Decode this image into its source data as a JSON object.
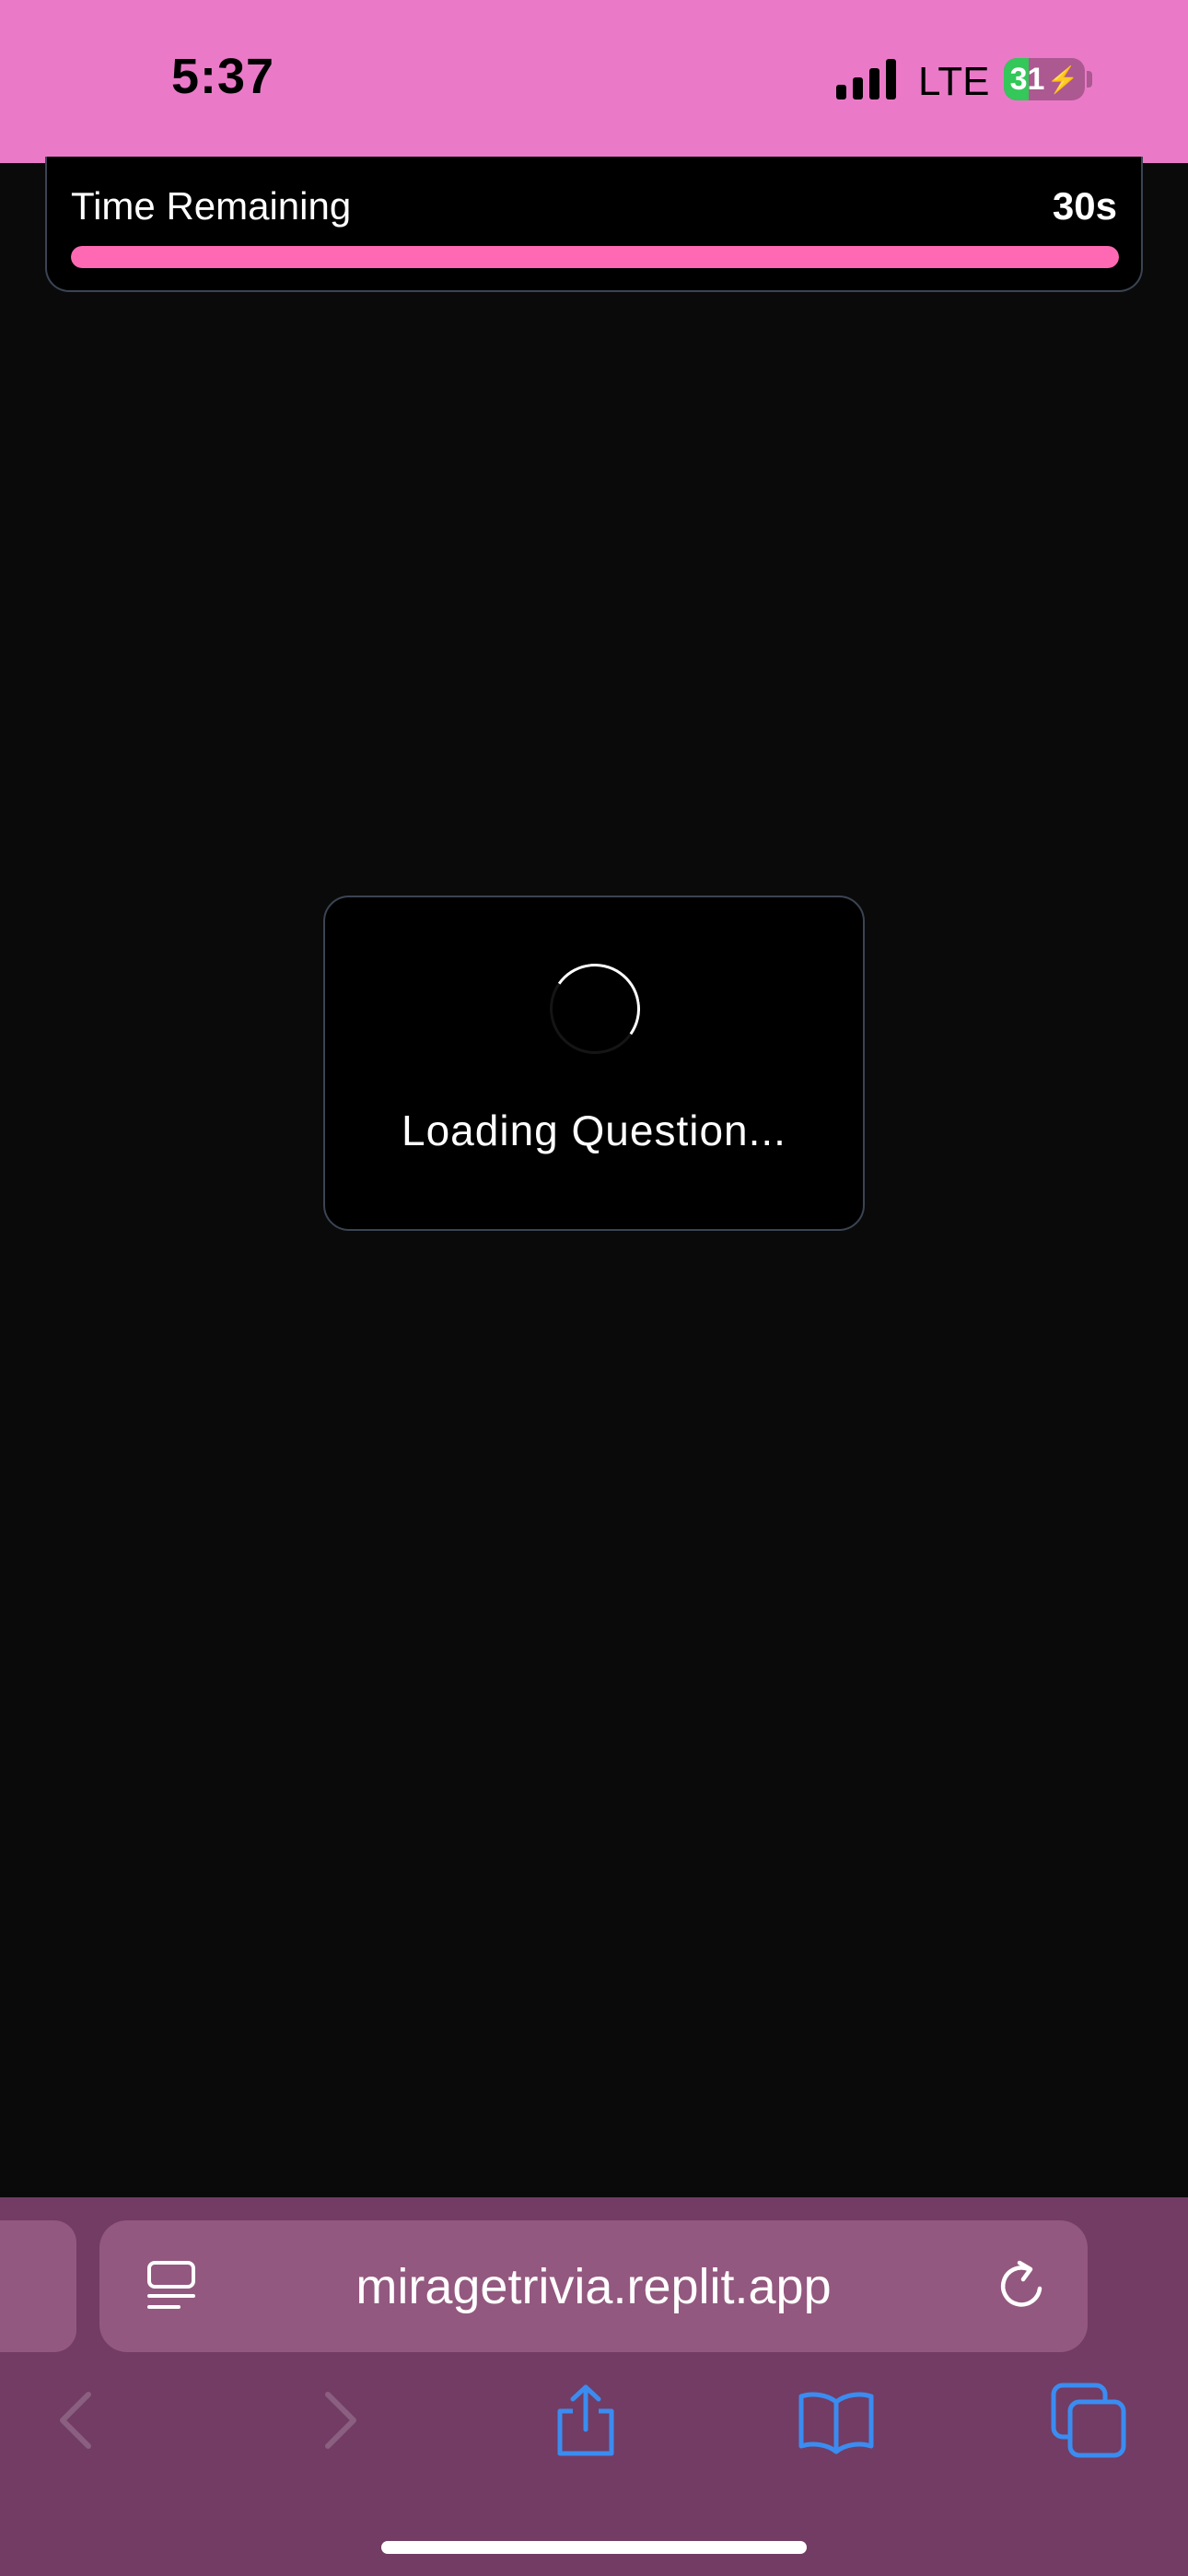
{
  "status_bar": {
    "time": "5:37",
    "network": "LTE",
    "battery_percent": "31",
    "battery_level": 0.31,
    "background_color": "#ea7ac8"
  },
  "timer": {
    "label": "Time Remaining",
    "value": "30s",
    "progress_fraction": 1.0,
    "progress_color": "#ff69b4"
  },
  "loading": {
    "text": "Loading Question..."
  },
  "browser": {
    "url": "miragetrivia.replit.app",
    "toolbar_color": "#723c64",
    "icons": [
      "reader-mode-icon",
      "reload-icon",
      "back-icon",
      "forward-icon",
      "share-icon",
      "bookmarks-icon",
      "tabs-icon"
    ],
    "accent_color": "#3b8cf0"
  }
}
